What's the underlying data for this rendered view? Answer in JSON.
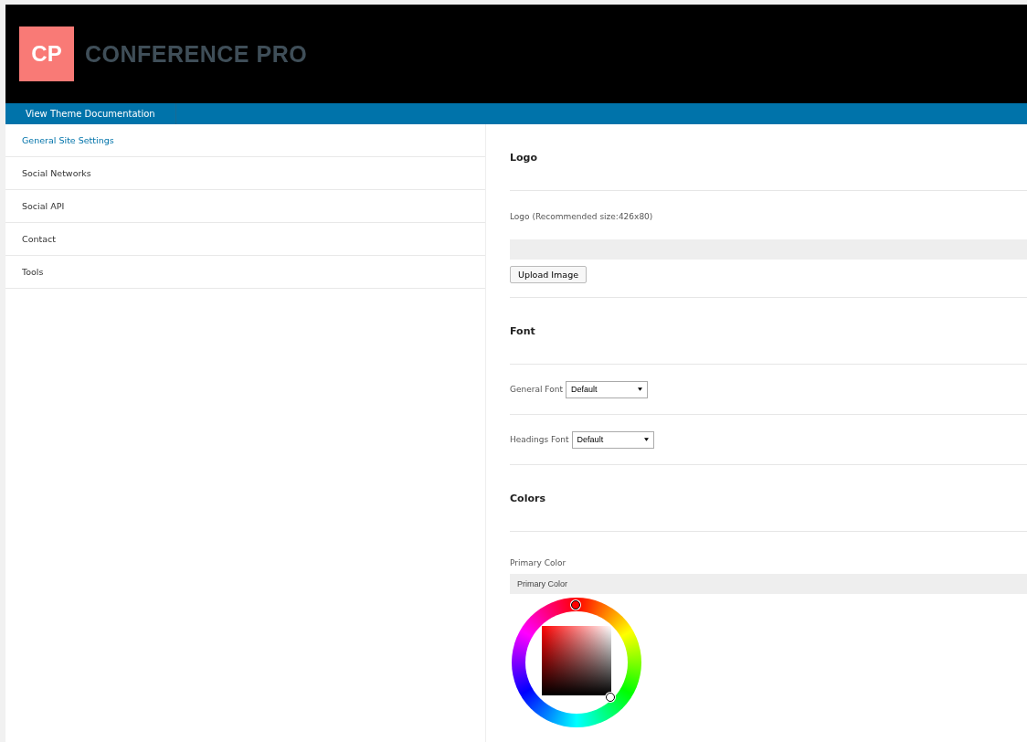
{
  "header": {
    "logo_mark": "CP",
    "logo_text": "CONFERENCE PRO"
  },
  "nav": {
    "links": [
      "View Theme Documentation"
    ]
  },
  "sidebar": {
    "items": [
      {
        "label": "General Site Settings",
        "selected": true
      },
      {
        "label": "Social Networks",
        "selected": false
      },
      {
        "label": "Social API",
        "selected": false
      },
      {
        "label": "Contact",
        "selected": false
      },
      {
        "label": "Tools",
        "selected": false
      }
    ]
  },
  "sections": [
    {
      "kind": "heading",
      "title": "Logo"
    },
    {
      "kind": "upload",
      "label": "Logo (Recommended size:426x80)",
      "button": "Upload Image"
    },
    {
      "kind": "heading",
      "title": "Font"
    },
    {
      "kind": "select",
      "label": "General Font",
      "value": "Default"
    },
    {
      "kind": "select",
      "label": "Headings Font",
      "value": "Default"
    },
    {
      "kind": "heading",
      "title": "Colors"
    },
    {
      "kind": "color",
      "label": "Primary Color",
      "value": "Primary Color"
    }
  ]
}
